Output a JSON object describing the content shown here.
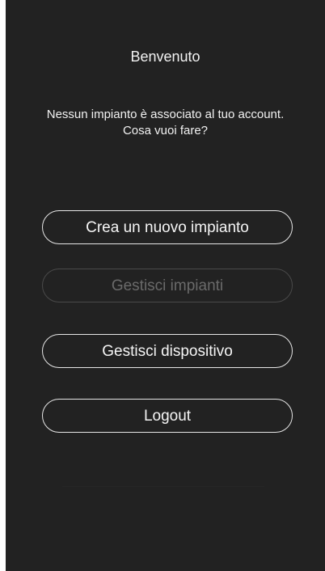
{
  "screen": {
    "title": "Benvenuto",
    "message_line1": "Nessun impianto è associato al tuo account.",
    "message_line2": "Cosa vuoi fare?"
  },
  "buttons": {
    "create_plant": "Crea un nuovo impianto",
    "manage_plants": "Gestisci impianti",
    "manage_device": "Gestisci dispositivo",
    "logout": "Logout"
  },
  "colors": {
    "background": "#222222",
    "text": "#f2f2f2",
    "button_border": "#e6e6e6",
    "disabled": "#6a6a6a"
  }
}
